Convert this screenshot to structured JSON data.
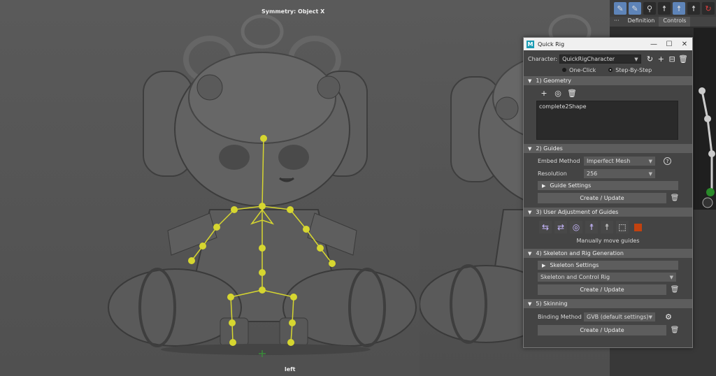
{
  "viewport_left": {
    "top_label": "Symmetry: Object X",
    "bottom_label": "left"
  },
  "side_panel": {
    "toolbar_icons": [
      "paint-brush-icon",
      "paint-brush-icon",
      "skeleton-icon",
      "figure-icon",
      "figure-icon",
      "figure-icon",
      "redo-icon"
    ],
    "tabs": [
      "···",
      "Definition",
      "Controls"
    ]
  },
  "dialog": {
    "title": "Quick Rig",
    "app_logo": "M",
    "character_label": "Character:",
    "character_value": "QuickRigCharacter",
    "mode_options": [
      "One-Click",
      "Step-By-Step"
    ],
    "mode_selected": "Step-By-Step",
    "sections": {
      "geometry": {
        "title": "1) Geometry",
        "items": [
          "complete2Shape"
        ]
      },
      "guides": {
        "title": "2) Guides",
        "embed_label": "Embed Method",
        "embed_value": "Imperfect Mesh",
        "resolution_label": "Resolution",
        "resolution_value": "256",
        "settings_label": "Guide Settings",
        "button": "Create / Update"
      },
      "adjust": {
        "title": "3) User Adjustment of Guides",
        "hint": "Manually move guides",
        "swatch_color": "#c2420f"
      },
      "skeleton": {
        "title": "4) Skeleton and Rig Generation",
        "settings_label": "Skeleton Settings",
        "option_value": "Skeleton and Control Rig",
        "button": "Create / Update"
      },
      "skinning": {
        "title": "5) Skinning",
        "binding_label": "Binding Method",
        "binding_value": "GVB (default settings)",
        "button": "Create / Update"
      }
    }
  }
}
